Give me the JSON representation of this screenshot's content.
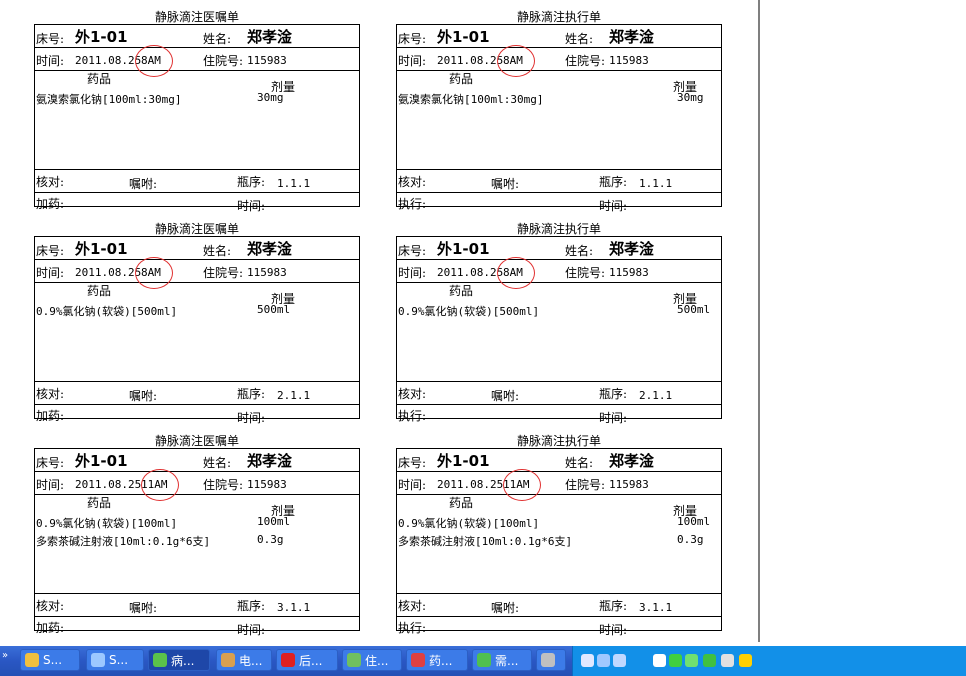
{
  "forms": [
    {
      "title": "静脉滴注医嘱单",
      "bed_label": "床号:",
      "bed": "外1-01",
      "name_label": "姓名:",
      "name": "郑孝淦",
      "time_label": "时间:",
      "date": "2011.08.25",
      "slot": "8AM",
      "admit_label": "住院号:",
      "admit": "115983",
      "drug_header": "药品",
      "dose_header": "剂量",
      "drugs": [
        {
          "name": "氨溴索氯化钠[100ml:30mg]",
          "dose": "30mg"
        },
        {
          "name": "",
          "dose": ""
        }
      ],
      "check_label": "核对:",
      "order_label": "嘱咐:",
      "seq_label": "瓶序:",
      "seq": "1.1.1",
      "act_label": "加药:",
      "time2_label": "时间:"
    },
    {
      "title": "静脉滴注执行单",
      "bed_label": "床号:",
      "bed": "外1-01",
      "name_label": "姓名:",
      "name": "郑孝淦",
      "time_label": "时间:",
      "date": "2011.08.25",
      "slot": "8AM",
      "admit_label": "住院号:",
      "admit": "115983",
      "drug_header": "药品",
      "dose_header": "剂量",
      "drugs": [
        {
          "name": "氨溴索氯化钠[100ml:30mg]",
          "dose": "30mg"
        },
        {
          "name": "",
          "dose": ""
        }
      ],
      "check_label": "核对:",
      "order_label": "嘱咐:",
      "seq_label": "瓶序:",
      "seq": "1.1.1",
      "act_label": "执行:",
      "time2_label": "时间:"
    },
    {
      "title": "静脉滴注医嘱单",
      "bed_label": "床号:",
      "bed": "外1-01",
      "name_label": "姓名:",
      "name": "郑孝淦",
      "time_label": "时间:",
      "date": "2011.08.25",
      "slot": "8AM",
      "admit_label": "住院号:",
      "admit": "115983",
      "drug_header": "药品",
      "dose_header": "剂量",
      "drugs": [
        {
          "name": "0.9%氯化钠(软袋)[500ml]",
          "dose": "500ml"
        },
        {
          "name": "",
          "dose": ""
        }
      ],
      "check_label": "核对:",
      "order_label": "嘱咐:",
      "seq_label": "瓶序:",
      "seq": "2.1.1",
      "act_label": "加药:",
      "time2_label": "时间:"
    },
    {
      "title": "静脉滴注执行单",
      "bed_label": "床号:",
      "bed": "外1-01",
      "name_label": "姓名:",
      "name": "郑孝淦",
      "time_label": "时间:",
      "date": "2011.08.25",
      "slot": "8AM",
      "admit_label": "住院号:",
      "admit": "115983",
      "drug_header": "药品",
      "dose_header": "剂量",
      "drugs": [
        {
          "name": "0.9%氯化钠(软袋)[500ml]",
          "dose": "500ml"
        },
        {
          "name": "",
          "dose": ""
        }
      ],
      "check_label": "核对:",
      "order_label": "嘱咐:",
      "seq_label": "瓶序:",
      "seq": "2.1.1",
      "act_label": "执行:",
      "time2_label": "时间:"
    },
    {
      "title": "静脉滴注医嘱单",
      "bed_label": "床号:",
      "bed": "外1-01",
      "name_label": "姓名:",
      "name": "郑孝淦",
      "time_label": "时间:",
      "date": "2011.08.25",
      "slot": "11AM",
      "admit_label": "住院号:",
      "admit": "115983",
      "drug_header": "药品",
      "dose_header": "剂量",
      "drugs": [
        {
          "name": "0.9%氯化钠(软袋)[100ml]",
          "dose": "100ml"
        },
        {
          "name": "多索茶碱注射液[10ml:0.1g*6支]",
          "dose": "0.3g"
        }
      ],
      "check_label": "核对:",
      "order_label": "嘱咐:",
      "seq_label": "瓶序:",
      "seq": "3.1.1",
      "act_label": "加药:",
      "time2_label": "时间:"
    },
    {
      "title": "静脉滴注执行单",
      "bed_label": "床号:",
      "bed": "外1-01",
      "name_label": "姓名:",
      "name": "郑孝淦",
      "time_label": "时间:",
      "date": "2011.08.25",
      "slot": "11AM",
      "admit_label": "住院号:",
      "admit": "115983",
      "drug_header": "药品",
      "dose_header": "剂量",
      "drugs": [
        {
          "name": "0.9%氯化钠(软袋)[100ml]",
          "dose": "100ml"
        },
        {
          "name": "多索茶碱注射液[10ml:0.1g*6支]",
          "dose": "0.3g"
        }
      ],
      "check_label": "核对:",
      "order_label": "嘱咐:",
      "seq_label": "瓶序:",
      "seq": "3.1.1",
      "act_label": "执行:",
      "time2_label": "时间:"
    }
  ],
  "taskbar": {
    "grip": "»",
    "buttons": [
      {
        "label": "S...",
        "icon": "gear-icon",
        "color": "#f0c040"
      },
      {
        "label": "S...",
        "icon": "monitor-icon",
        "color": "#9cc8ff"
      },
      {
        "label": "病...",
        "icon": "check-icon",
        "color": "#5bc24a"
      },
      {
        "label": "电...",
        "icon": "person-icon",
        "color": "#d9a050"
      },
      {
        "label": "后...",
        "icon": "red-cross-icon",
        "color": "#e02020"
      },
      {
        "label": "住...",
        "icon": "building-icon",
        "color": "#70c060"
      },
      {
        "label": "药...",
        "icon": "pill-icon",
        "color": "#e04040"
      },
      {
        "label": "需...",
        "icon": "refresh-icon",
        "color": "#50c050"
      },
      {
        "label": "",
        "icon": "keyboard-icon",
        "color": "#c0c0c0"
      }
    ],
    "tray_icons": [
      {
        "icon": "mail-icon",
        "color": "#e0e8ff"
      },
      {
        "icon": "network-icon",
        "color": "#a0c8ff"
      },
      {
        "icon": "computer-icon",
        "color": "#c0d8ff"
      },
      {
        "icon": "volume-icon",
        "color": "#ffffff"
      },
      {
        "icon": "signal-icon",
        "color": "#40d040"
      },
      {
        "icon": "pen-icon",
        "color": "#70e070"
      },
      {
        "icon": "shield-icon",
        "color": "#40c040"
      },
      {
        "icon": "gear-icon",
        "color": "#e0e0e0"
      },
      {
        "icon": "plus-icon",
        "color": "#ffd000"
      }
    ]
  }
}
